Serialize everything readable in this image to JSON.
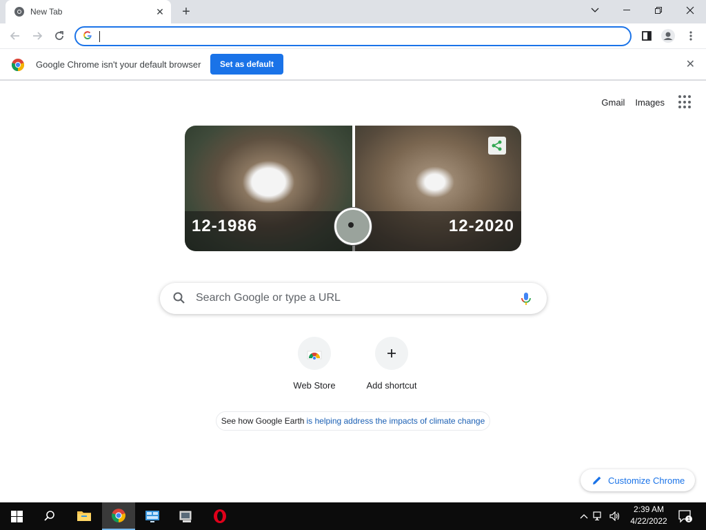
{
  "tab": {
    "title": "New Tab",
    "favicon": "chrome-icon"
  },
  "window_controls": [
    "chevron-down-icon",
    "minimize-icon",
    "restore-icon",
    "close-icon"
  ],
  "omnibox": {
    "value": "",
    "placeholder": ""
  },
  "infobar": {
    "message": "Google Chrome isn't your default browser",
    "button": "Set as default"
  },
  "top_links": {
    "gmail": "Gmail",
    "images": "Images"
  },
  "doodle": {
    "left_label": "12-1986",
    "right_label": "12-2020"
  },
  "search": {
    "placeholder": "Search Google or type a URL"
  },
  "shortcuts": [
    {
      "label": "Web Store",
      "icon": "web-store-icon"
    },
    {
      "label": "Add shortcut",
      "icon": "plus-icon"
    }
  ],
  "earth_link": {
    "prefix": "See how Google Earth",
    "link": "is helping address the impacts of climate change"
  },
  "customize": {
    "label": "Customize Chrome"
  },
  "taskbar": {
    "apps": [
      "start-icon",
      "search-icon",
      "file-explorer-icon",
      "chrome-icon",
      "control-panel-icon",
      "device-manager-icon",
      "opera-icon"
    ],
    "time": "2:39 AM",
    "date": "4/22/2022",
    "notification_count": "1"
  }
}
